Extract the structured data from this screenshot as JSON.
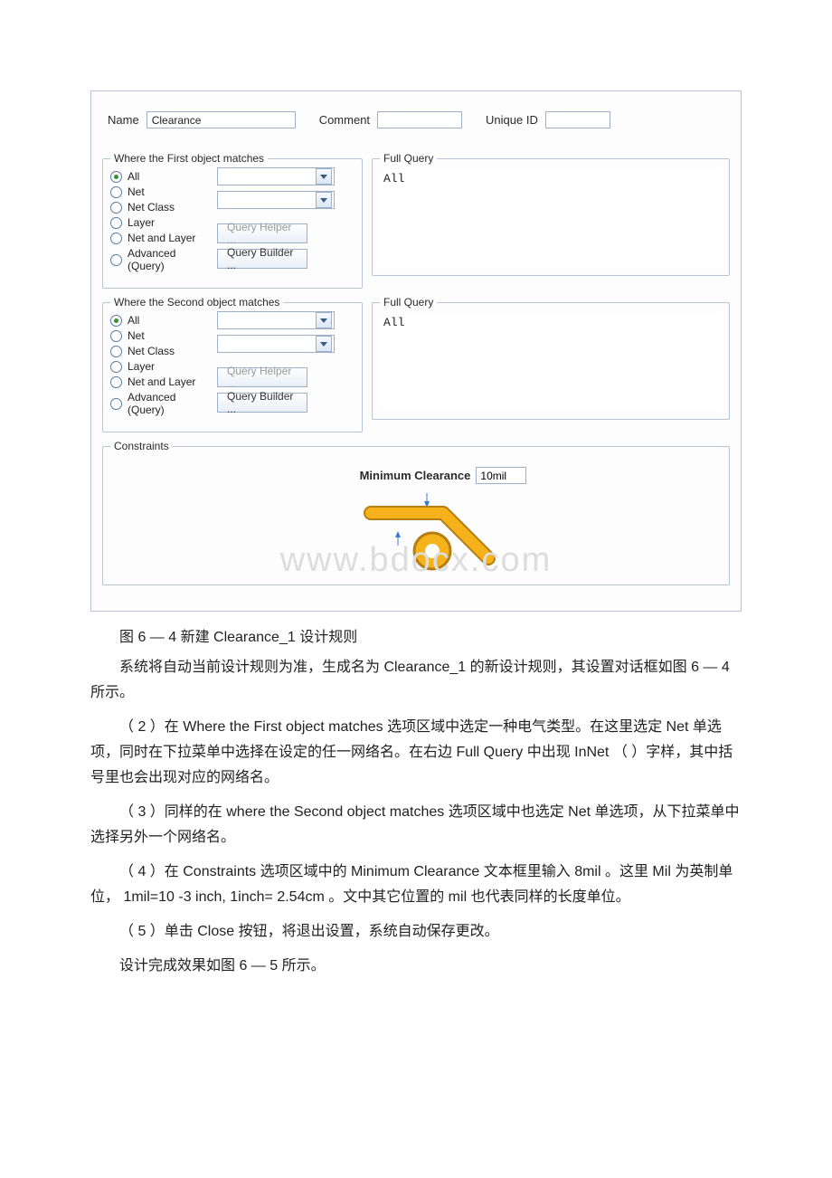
{
  "dialog": {
    "name_label": "Name",
    "name_value": "Clearance",
    "comment_label": "Comment",
    "comment_value": "",
    "uniqueid_label": "Unique ID",
    "uniqueid_value": "",
    "first_matches_title": "Where the First object matches",
    "second_matches_title": "Where the Second object matches",
    "radios": {
      "all": "All",
      "net": "Net",
      "netclass": "Net Class",
      "layer": "Layer",
      "netlayer": "Net and Layer",
      "advanced": "Advanced (Query)"
    },
    "query_helper_btn": "Query Helper ...",
    "query_builder_btn": "Query Builder ...",
    "full_query_title": "Full Query",
    "full_query_value": "All",
    "constraints_title": "Constraints",
    "min_clear_label": "Minimum Clearance",
    "min_clear_value": "10mil"
  },
  "text": {
    "caption": "图 6 — 4 新建 Clearance_1 设计规则",
    "p1": "系统将自动当前设计规则为准，生成名为 Clearance_1 的新设计规则，其设置对话框如图 6 — 4 所示。",
    "p2": "（ 2 ）在 Where the First object matches 选项区域中选定一种电气类型。在这里选定 Net 单选项，同时在下拉菜单中选择在设定的任一网络名。在右边 Full Query 中出现 InNet （ ）字样，其中括号里也会出现对应的网络名。",
    "p3": "（ 3 ）同样的在 where the Second object matches 选项区域中也选定 Net 单选项，从下拉菜单中选择另外一个网络名。",
    "p4": "（ 4 ）在 Constraints 选项区域中的 Minimum Clearance 文本框里输入 8mil 。这里 Mil 为英制单位， 1mil=10 -3 inch, 1inch= 2.54cm 。文中其它位置的 mil 也代表同样的长度单位。",
    "p5": "（ 5 ）单击 Close 按钮，将退出设置，系统自动保存更改。",
    "p6": "设计完成效果如图 6 — 5 所示。"
  },
  "watermark": "www.bdocx.com"
}
